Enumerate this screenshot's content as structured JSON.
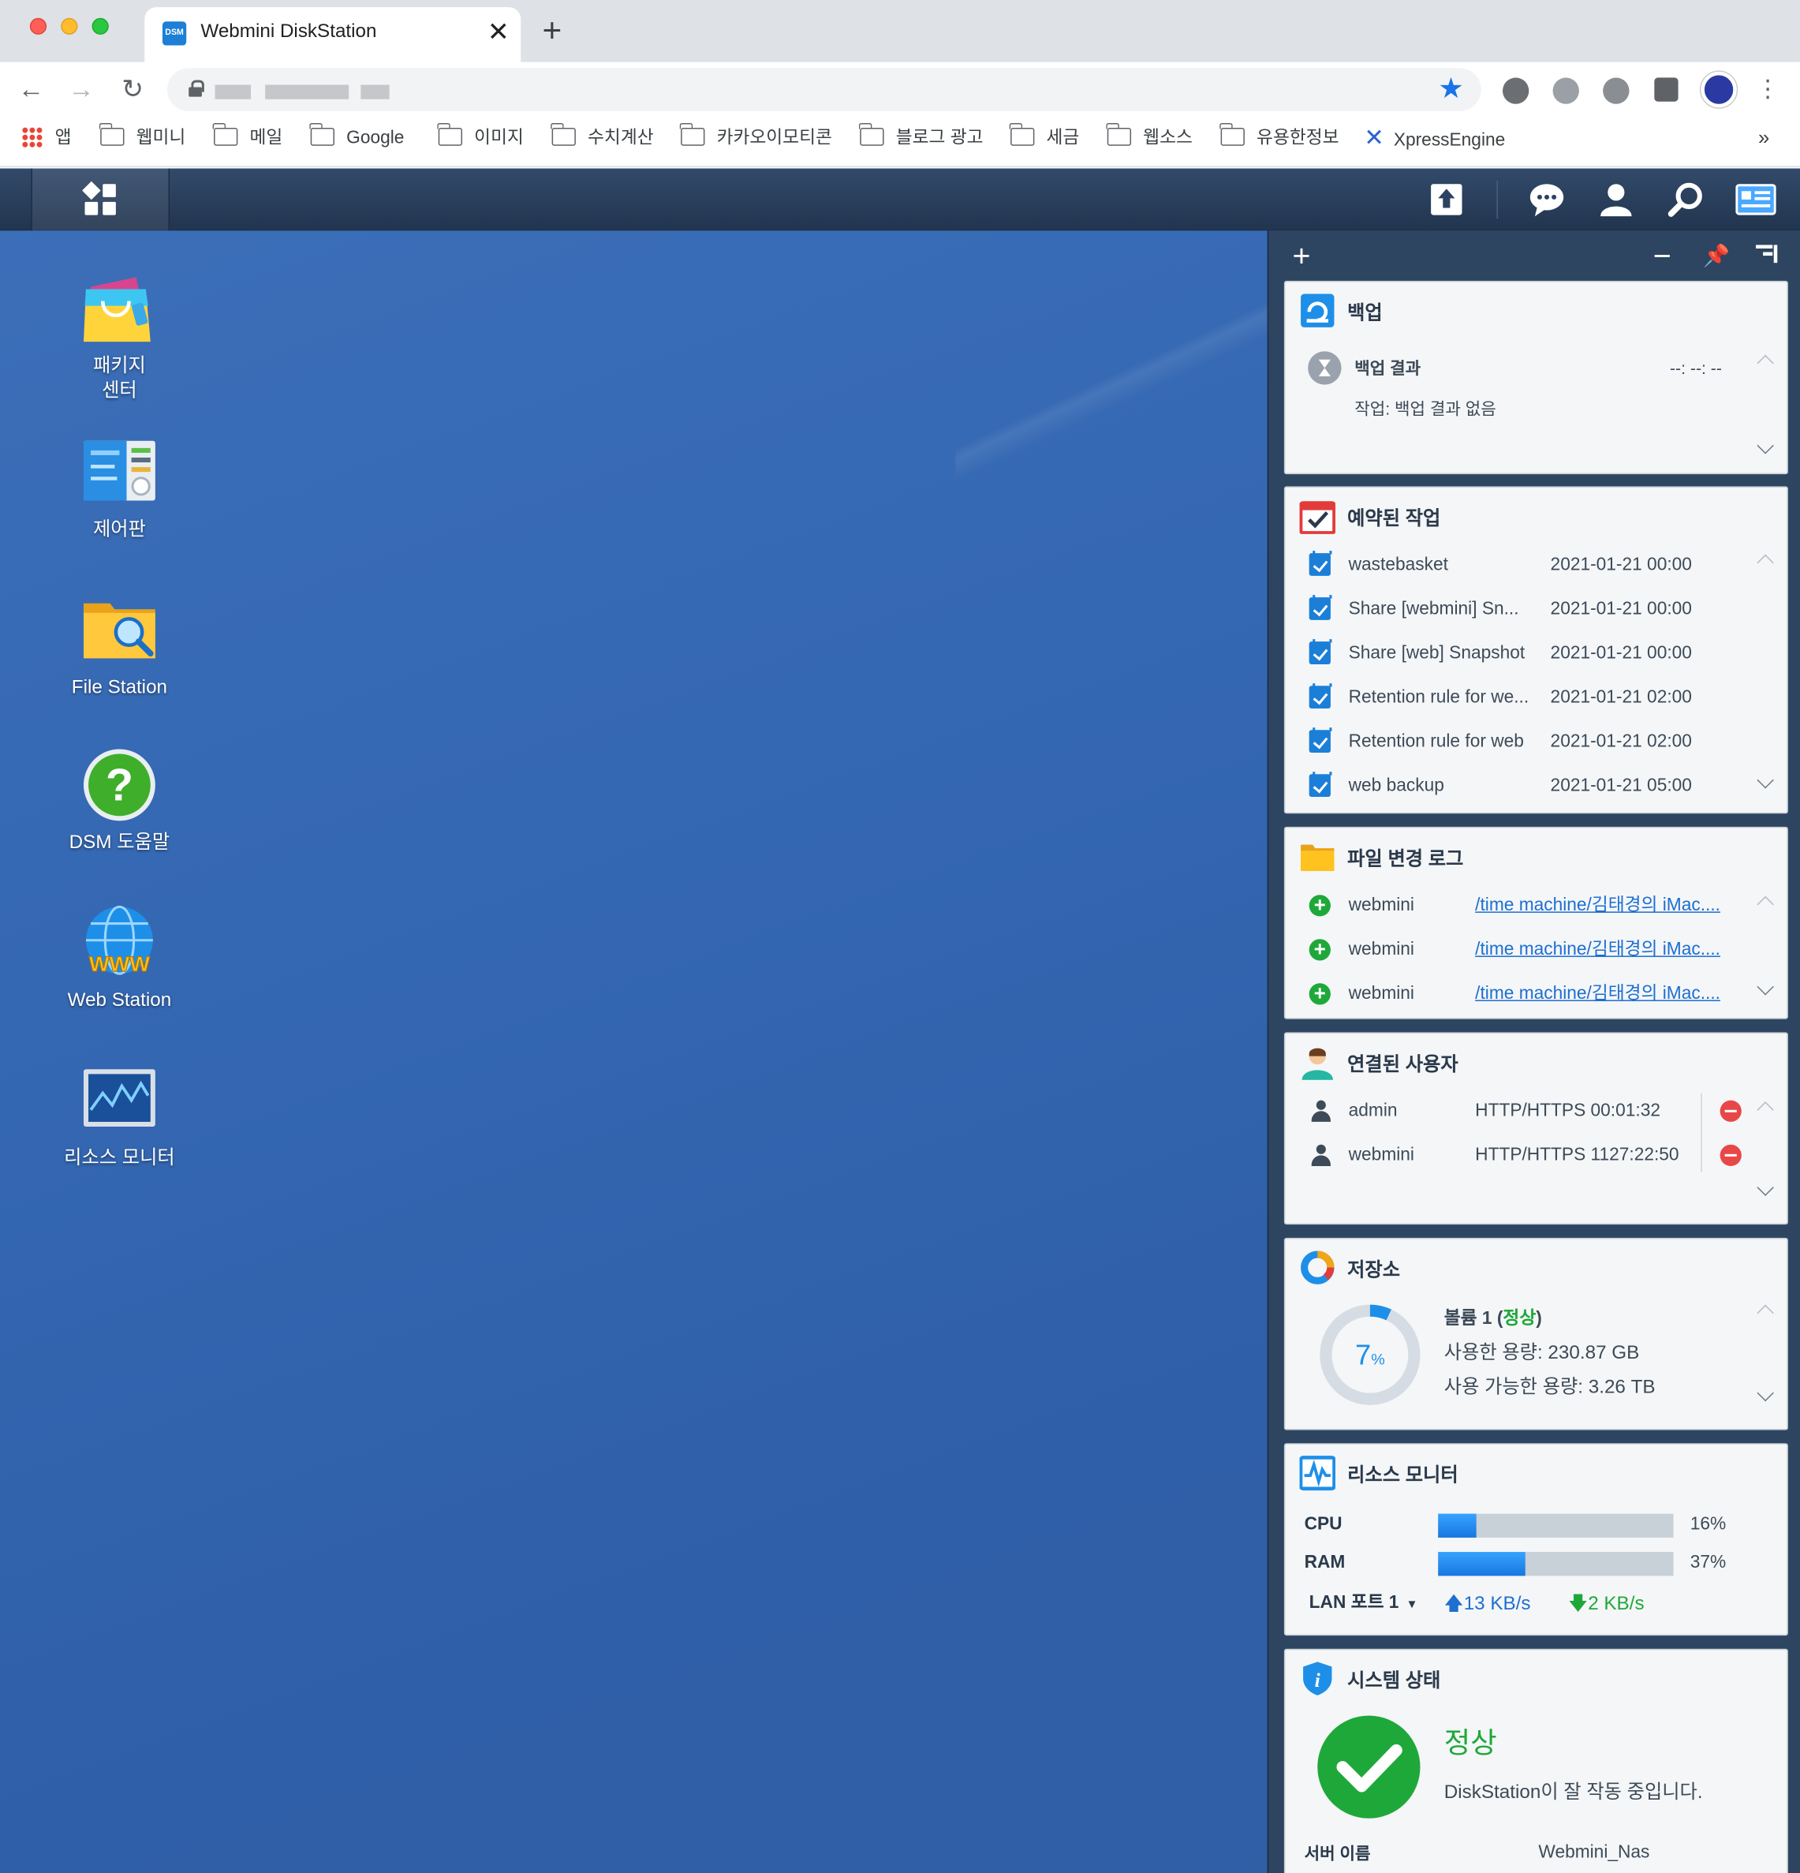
{
  "browser": {
    "tab_title": "Webmini DiskStation",
    "tab_favicon": "DSM",
    "bookmarks": [
      "앱",
      "웹미니",
      "메일",
      "Google",
      "이미지",
      "수치계산",
      "카카오이모티콘",
      "블로그 광고",
      "세금",
      "웹소스",
      "유용한정보",
      "XpressEngine"
    ],
    "bookmarks_more": "»"
  },
  "desktop": {
    "icons": [
      {
        "label": "패키지\n센터",
        "icon": "package-center-icon"
      },
      {
        "label": "제어판",
        "icon": "control-panel-icon"
      },
      {
        "label": "File Station",
        "icon": "file-station-icon"
      },
      {
        "label": "DSM 도움말",
        "icon": "dsm-help-icon"
      },
      {
        "label": "Web Station",
        "icon": "web-station-icon"
      },
      {
        "label": "리소스 모니터",
        "icon": "resource-monitor-icon"
      }
    ]
  },
  "widgets": {
    "backup": {
      "title": "백업",
      "result_label": "백업 결과",
      "result_time": "--: --: --",
      "task_text": "작업: 백업 결과 없음"
    },
    "scheduled": {
      "title": "예약된 작업",
      "tasks": [
        {
          "name": "wastebasket",
          "time": "2021-01-21 00:00"
        },
        {
          "name": "Share [webmini] Sn...",
          "time": "2021-01-21 00:00"
        },
        {
          "name": "Share [web] Snapshot",
          "time": "2021-01-21 00:00"
        },
        {
          "name": "Retention rule for we...",
          "time": "2021-01-21 02:00"
        },
        {
          "name": "Retention rule for web",
          "time": "2021-01-21 02:00"
        },
        {
          "name": "web backup",
          "time": "2021-01-21 05:00"
        }
      ]
    },
    "filelog": {
      "title": "파일 변경 로그",
      "entries": [
        {
          "user": "webmini",
          "path": "/time machine/김태경의 iMac...."
        },
        {
          "user": "webmini",
          "path": "/time machine/김태경의 iMac...."
        },
        {
          "user": "webmini",
          "path": "/time machine/김태경의 iMac...."
        }
      ]
    },
    "users": {
      "title": "연결된 사용자",
      "list": [
        {
          "name": "admin",
          "info": "HTTP/HTTPS 00:01:32"
        },
        {
          "name": "webmini",
          "info": "HTTP/HTTPS 1127:22:50"
        }
      ]
    },
    "storage": {
      "title": "저장소",
      "percent": "7",
      "percent_unit": "%",
      "used_fraction": 0.07,
      "volume_label": "볼륨 1 (",
      "volume_status": "정상",
      "volume_close": ")",
      "used": "사용한 용량: 230.87 GB",
      "available": "사용 가능한 용량: 3.26 TB"
    },
    "resource": {
      "title": "리소스 모니터",
      "cpu_label": "CPU",
      "cpu_value": "16%",
      "cpu_fraction": 0.16,
      "ram_label": "RAM",
      "ram_value": "37%",
      "ram_fraction": 0.37,
      "lan_label": "LAN 포트 1",
      "upload": "13 KB/s",
      "download": "2 KB/s"
    },
    "system": {
      "title": "시스템 상태",
      "status": "정상",
      "message": "DiskStation이 잘 작동 중입니다.",
      "server_label": "서버 이름",
      "server_name": "Webmini_Nas"
    }
  },
  "colors": {
    "accent": "#1777e0",
    "ok_green": "#1fa83a",
    "desktop_bg": "#3467b2"
  }
}
